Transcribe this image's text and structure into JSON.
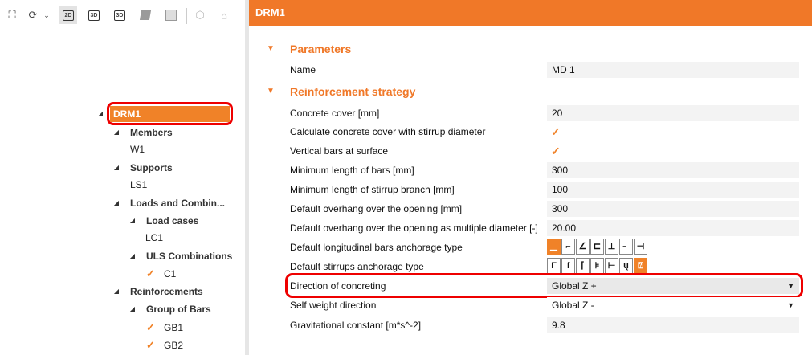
{
  "toolbar": {
    "items": [
      {
        "name": "fit-view-icon",
        "glyph": "⛶"
      },
      {
        "name": "rotate-icon",
        "glyph": "⟳"
      },
      {
        "name": "view-2d-button",
        "label": "2D"
      },
      {
        "name": "view-3d-button",
        "label": "3D"
      },
      {
        "name": "view-3d-alt-button",
        "label": "3D"
      }
    ]
  },
  "tree": {
    "root": "DRM1",
    "members_label": "Members",
    "member_w1": "W1",
    "supports_label": "Supports",
    "support_ls1": "LS1",
    "loads_label": "Loads and Combin...",
    "load_cases_label": "Load cases",
    "load_case_lc1": "LC1",
    "uls_label": "ULS Combinations",
    "uls_c1": "C1",
    "reinforcements_label": "Reinforcements",
    "group_of_bars_label": "Group of Bars",
    "gb1": "GB1",
    "gb2": "GB2"
  },
  "panel": {
    "title": "DRM1",
    "parameters_title": "Parameters",
    "name_label": "Name",
    "name_value": "MD 1",
    "reinforcement_title": "Reinforcement strategy",
    "rows": [
      {
        "label": "Concrete cover [mm]",
        "value": "20"
      },
      {
        "label": "Calculate concrete cover with stirrup diameter",
        "checked": true
      },
      {
        "label": "Vertical bars at surface",
        "checked": true
      },
      {
        "label": "Minimum length of bars [mm]",
        "value": "300"
      },
      {
        "label": "Minimum length of stirrup branch [mm]",
        "value": "100"
      },
      {
        "label": "Default overhang over the opening [mm]",
        "value": "300"
      },
      {
        "label": "Default overhang over the opening as multiple diameter [-]",
        "value": "20.00"
      },
      {
        "label": "Default longitudinal bars anchorage type"
      },
      {
        "label": "Default stirrups anchorage type"
      },
      {
        "label": "Direction of concreting",
        "value": "Global Z +"
      },
      {
        "label": "Self weight direction",
        "value": "Global Z -"
      },
      {
        "label": "Gravitational constant [m*s^-2]",
        "value": "9.8"
      }
    ],
    "long_anchorage_selected_index": 0,
    "stirrup_anchorage_selected_index": 5,
    "accent_color": "#f07828",
    "highlight_color": "#e00000"
  }
}
